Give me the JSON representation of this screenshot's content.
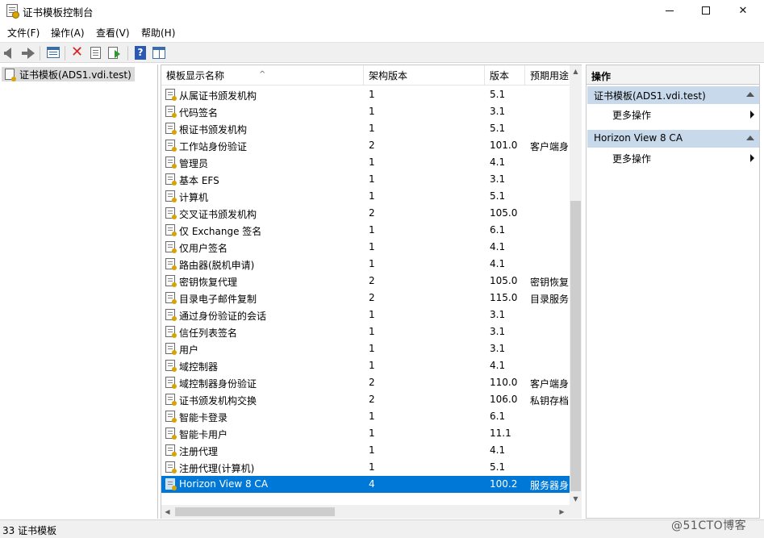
{
  "window": {
    "title": "证书模板控制台"
  },
  "menu": [
    {
      "label": "文件(F)"
    },
    {
      "label": "操作(A)"
    },
    {
      "label": "查看(V)"
    },
    {
      "label": "帮助(H)"
    }
  ],
  "toolbar": {
    "buttons": [
      "back-icon",
      "forward-icon",
      "show-hide-pane-icon",
      "delete-icon",
      "properties-icon",
      "export-list-icon",
      "help-icon",
      "show-hide-action-pane-icon"
    ]
  },
  "tree": {
    "root_label": "证书模板(ADS1.vdi.test)"
  },
  "list": {
    "columns": [
      "模板显示名称",
      "架构版本",
      "版本",
      "预期用途"
    ],
    "rows": [
      {
        "name": "从属证书颁发机构",
        "schema": "1",
        "version": "5.1",
        "purpose": ""
      },
      {
        "name": "代码签名",
        "schema": "1",
        "version": "3.1",
        "purpose": ""
      },
      {
        "name": "根证书颁发机构",
        "schema": "1",
        "version": "5.1",
        "purpose": ""
      },
      {
        "name": "工作站身份验证",
        "schema": "2",
        "version": "101.0",
        "purpose": "客户端身"
      },
      {
        "name": "管理员",
        "schema": "1",
        "version": "4.1",
        "purpose": ""
      },
      {
        "name": "基本 EFS",
        "schema": "1",
        "version": "3.1",
        "purpose": ""
      },
      {
        "name": "计算机",
        "schema": "1",
        "version": "5.1",
        "purpose": ""
      },
      {
        "name": "交叉证书颁发机构",
        "schema": "2",
        "version": "105.0",
        "purpose": ""
      },
      {
        "name": "仅 Exchange 签名",
        "schema": "1",
        "version": "6.1",
        "purpose": ""
      },
      {
        "name": "仅用户签名",
        "schema": "1",
        "version": "4.1",
        "purpose": ""
      },
      {
        "name": "路由器(脱机申请)",
        "schema": "1",
        "version": "4.1",
        "purpose": ""
      },
      {
        "name": "密钥恢复代理",
        "schema": "2",
        "version": "105.0",
        "purpose": "密钥恢复"
      },
      {
        "name": "目录电子邮件复制",
        "schema": "2",
        "version": "115.0",
        "purpose": "目录服务"
      },
      {
        "name": "通过身份验证的会话",
        "schema": "1",
        "version": "3.1",
        "purpose": ""
      },
      {
        "name": "信任列表签名",
        "schema": "1",
        "version": "3.1",
        "purpose": ""
      },
      {
        "name": "用户",
        "schema": "1",
        "version": "3.1",
        "purpose": ""
      },
      {
        "name": "域控制器",
        "schema": "1",
        "version": "4.1",
        "purpose": ""
      },
      {
        "name": "域控制器身份验证",
        "schema": "2",
        "version": "110.0",
        "purpose": "客户端身"
      },
      {
        "name": "证书颁发机构交换",
        "schema": "2",
        "version": "106.0",
        "purpose": "私钥存档"
      },
      {
        "name": "智能卡登录",
        "schema": "1",
        "version": "6.1",
        "purpose": ""
      },
      {
        "name": "智能卡用户",
        "schema": "1",
        "version": "11.1",
        "purpose": ""
      },
      {
        "name": "注册代理",
        "schema": "1",
        "version": "4.1",
        "purpose": ""
      },
      {
        "name": "注册代理(计算机)",
        "schema": "1",
        "version": "5.1",
        "purpose": ""
      },
      {
        "name": "Horizon View 8 CA",
        "schema": "4",
        "version": "100.2",
        "purpose": "服务器身",
        "selected": true
      }
    ]
  },
  "actions": {
    "header": "操作",
    "sections": [
      {
        "title": "证书模板(ADS1.vdi.test)",
        "item": "更多操作"
      },
      {
        "title": "Horizon View 8 CA",
        "item": "更多操作"
      }
    ]
  },
  "status": {
    "text": "33 证书模板"
  },
  "watermark": "@51CTO博客",
  "colors": {
    "selection": "#0078d7",
    "action_section": "#c7d9ea"
  }
}
